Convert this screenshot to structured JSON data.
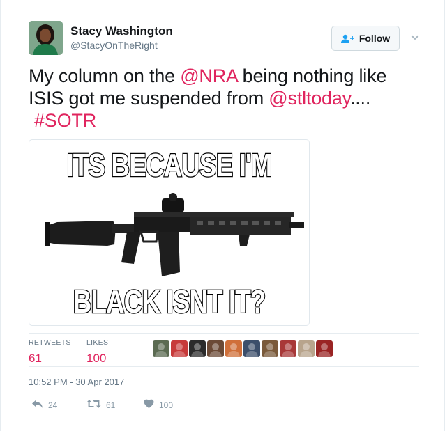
{
  "user": {
    "name": "Stacy Washington",
    "handle": "@StacyOnTheRight"
  },
  "follow_button": {
    "label": "Follow",
    "icon": "add-user-icon"
  },
  "tweet": {
    "text_part1": "My column on the ",
    "mention1": "@NRA",
    "text_part2": " being nothing like ISIS got me suspended from ",
    "mention2": "@stltoday",
    "text_part3": "....",
    "hashtag": "#SOTR"
  },
  "media": {
    "top_text": "ITS BECAUSE I'M",
    "bottom_text": "BLACK ISNT IT?",
    "subject": "rifle"
  },
  "stats": {
    "retweets_label": "RETWEETS",
    "retweets_value": "61",
    "likes_label": "LIKES",
    "likes_value": "100"
  },
  "likers": [
    {
      "color": "#5b6b52"
    },
    {
      "color": "#c73a3a"
    },
    {
      "color": "#2b2b2b"
    },
    {
      "color": "#6b4a36"
    },
    {
      "color": "#d0703a"
    },
    {
      "color": "#3c4f6b"
    },
    {
      "color": "#7a5a3a"
    },
    {
      "color": "#a83838"
    },
    {
      "color": "#b8a48c"
    },
    {
      "color": "#9a2424"
    }
  ],
  "timestamp": "10:52 PM - 30 Apr 2017",
  "actions": {
    "reply_count": "24",
    "retweet_count": "61",
    "like_count": "100"
  },
  "colors": {
    "link": "#e0245e",
    "secondary_text": "#657786",
    "icon_gray": "#8899a6"
  }
}
